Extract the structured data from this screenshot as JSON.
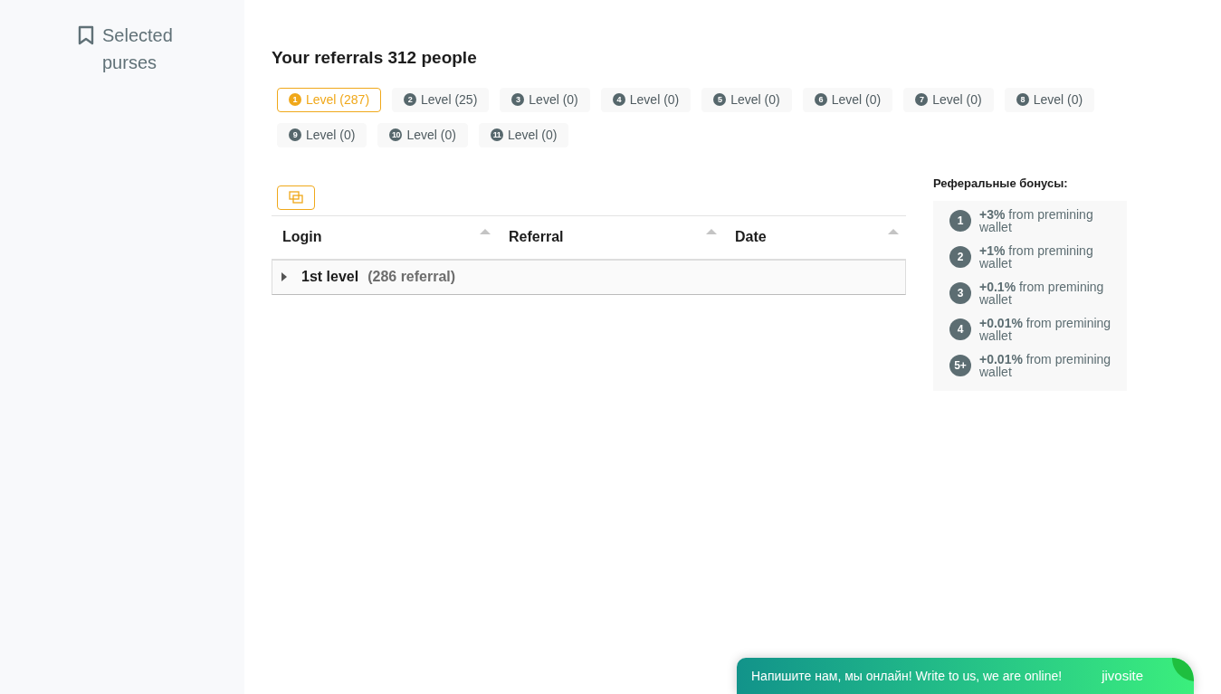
{
  "sidebar": {
    "items": [
      {
        "label": "Selected purses"
      }
    ]
  },
  "title": "Your referrals 312 people",
  "level_tabs": [
    {
      "number": "1",
      "label": "Level (287)",
      "selected": true
    },
    {
      "number": "2",
      "label": "Level (25)",
      "selected": false
    },
    {
      "number": "3",
      "label": "Level (0)",
      "selected": false
    },
    {
      "number": "4",
      "label": "Level (0)",
      "selected": false
    },
    {
      "number": "5",
      "label": "Level (0)",
      "selected": false
    },
    {
      "number": "6",
      "label": "Level (0)",
      "selected": false
    },
    {
      "number": "7",
      "label": "Level (0)",
      "selected": false
    },
    {
      "number": "8",
      "label": "Level (0)",
      "selected": false
    },
    {
      "number": "9",
      "label": "Level (0)",
      "selected": false
    },
    {
      "number": "10",
      "label": "Level (0)",
      "selected": false
    },
    {
      "number": "11",
      "label": "Level (0)",
      "selected": false
    }
  ],
  "table": {
    "columns": [
      "Login",
      "Referral",
      "Date"
    ],
    "groups": [
      {
        "label": "1st level",
        "count": "(286 referral)",
        "expanded": false
      }
    ]
  },
  "bonuses": {
    "title": "Реферальные бонусы:",
    "items": [
      {
        "badge": "1",
        "text": "**+3%** from premining wallet"
      },
      {
        "badge": "2",
        "text": "**+1%** from premining wallet"
      },
      {
        "badge": "3",
        "text": "**+0.1%** from premining wallet"
      },
      {
        "badge": "4",
        "text": "**+0.01%** from premining wallet"
      },
      {
        "badge": "5+",
        "text": "**+0.01%** from premining wallet"
      }
    ]
  },
  "chat": {
    "message": "Напишите нам, мы онлайн! Write to us, we are online!",
    "logo": "jivosite"
  }
}
